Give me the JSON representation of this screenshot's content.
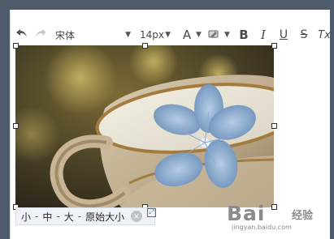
{
  "window": {
    "background": "#ffffff",
    "frame_color": "#4f5b6b"
  },
  "toolbar": {
    "undo_icon": "undo-icon",
    "redo_icon": "redo-icon",
    "font_family": "宋体",
    "font_size": "14px",
    "font_color_label": "A",
    "highlight_icon": "highlight-icon",
    "bold_label": "B",
    "italic_label": "I",
    "underline_label": "U",
    "strike_label": "S",
    "clear_label": "Tx"
  },
  "image": {
    "description": "teacup-with-blue-flower"
  },
  "image_size_bar": {
    "small": "小",
    "medium": "中",
    "large": "大",
    "original": "原始大小",
    "separator": "-",
    "close_icon": "close-icon",
    "expand_icon": "expand-icon"
  },
  "watermark": {
    "brand": "Bai",
    "brand2": "经验",
    "url": "jingyan.baidu.com"
  }
}
